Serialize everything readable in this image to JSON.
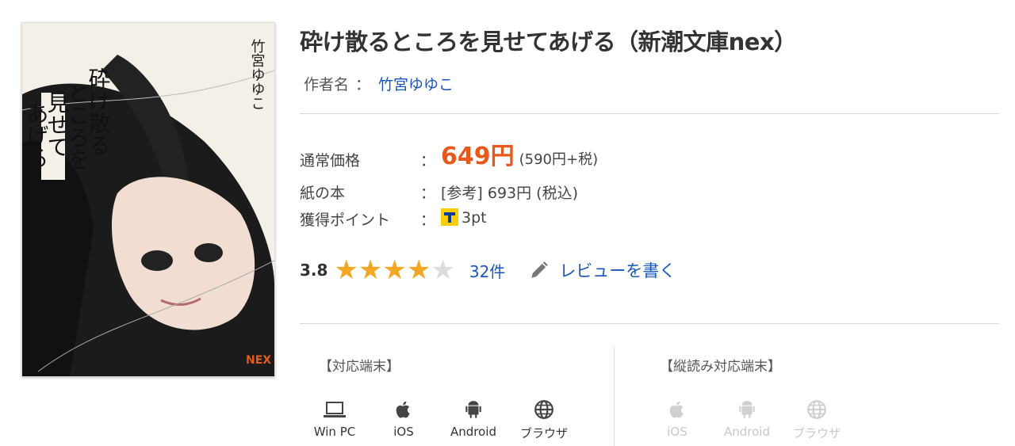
{
  "product": {
    "title": "砕け散るところを見せてあげる（新潮文庫nex）",
    "author_label": "作者名",
    "author_sep": "：",
    "author_name": "竹宮ゆゆこ"
  },
  "cover": {
    "spine_author": "竹宮ゆゆこ",
    "title_lines": [
      "砕け散る",
      "ところを",
      "見せて",
      "あげる"
    ],
    "publisher_mark": "NEX"
  },
  "pricing": {
    "regular_label": "通常価格",
    "colon": "：",
    "price": "649円",
    "price_tax": "(590円+税)",
    "paper_label": "紙の本",
    "paper_value": "[参考] 693円 (税込)",
    "points_label": "獲得ポイント",
    "points_value": "3pt",
    "accent_color": "#e8581a"
  },
  "rating": {
    "score": "3.8",
    "stars_filled": 4,
    "stars_total": 5,
    "star_glyph": "★",
    "count": "32件",
    "write_review": "レビューを書く"
  },
  "devices": {
    "header": "【対応端末】",
    "items": [
      {
        "label": "Win PC",
        "icon": "laptop-icon"
      },
      {
        "label": "iOS",
        "icon": "apple-icon"
      },
      {
        "label": "Android",
        "icon": "android-icon"
      },
      {
        "label": "ブラウザ",
        "icon": "globe-icon"
      }
    ]
  },
  "vertical_devices": {
    "header": "【縦読み対応端末】",
    "items": [
      {
        "label": "iOS",
        "icon": "apple-icon"
      },
      {
        "label": "Android",
        "icon": "android-icon"
      },
      {
        "label": "ブラウザ",
        "icon": "globe-icon"
      }
    ]
  }
}
